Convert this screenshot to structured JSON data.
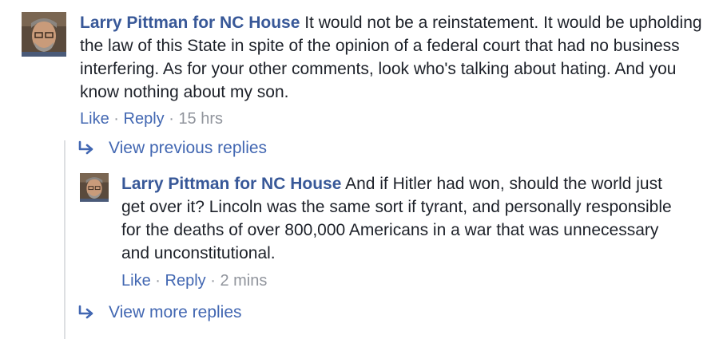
{
  "comments": [
    {
      "author": "Larry Pittman for NC House",
      "text": " It would not be a reinstatement. It would be upholding the law of this State in spite of the opinion of a federal court that had no business interfering. As for your other comments, look who's talking about hating. And you know nothing about my son.",
      "actions": {
        "like": "Like",
        "reply": "Reply",
        "separator": "·",
        "time": "15 hrs"
      }
    },
    {
      "author": "Larry Pittman for NC House",
      "text": " And if Hitler had won, should the world just get over it? Lincoln was the same sort if tyrant, and personally responsible for the deaths of over 800,000 Americans in a war that was unnecessary and unconstitutional.",
      "actions": {
        "like": "Like",
        "reply": "Reply",
        "separator": "·",
        "time": "2 mins"
      }
    }
  ],
  "view_previous": "View previous replies",
  "view_more": "View more replies",
  "colors": {
    "link": "#385898",
    "meta": "#90949c",
    "action": "#4267b2"
  }
}
